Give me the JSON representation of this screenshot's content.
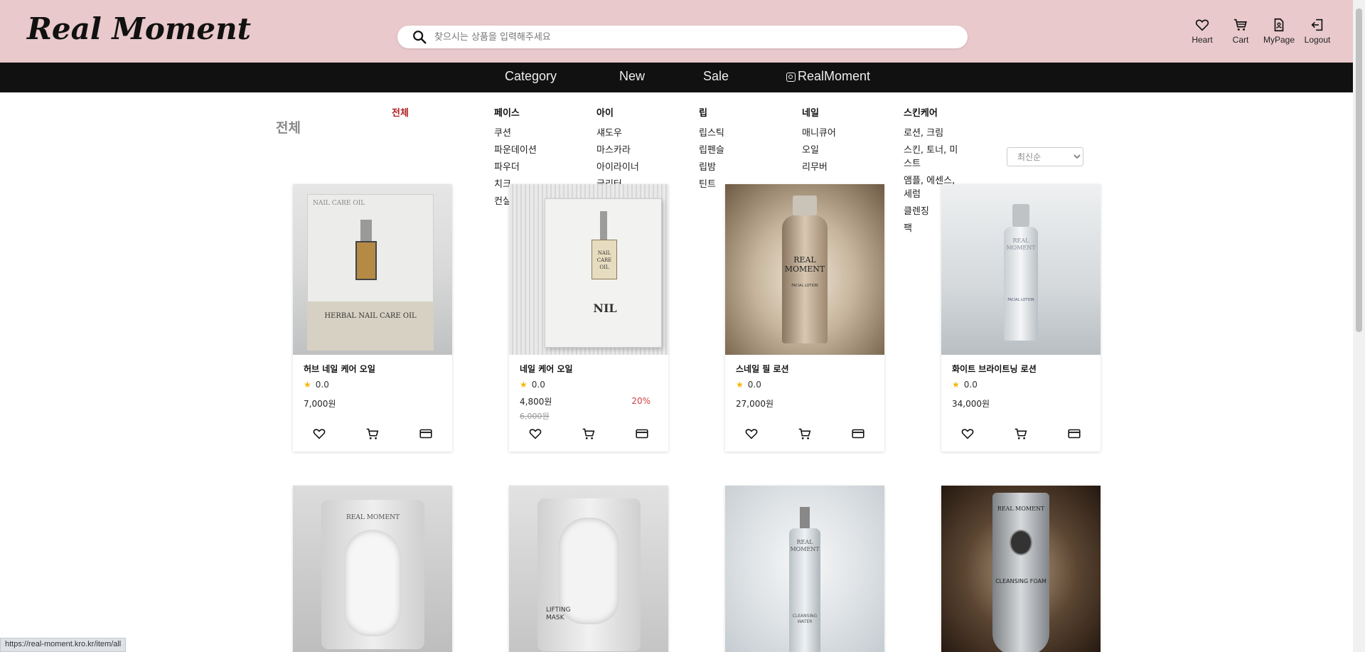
{
  "header": {
    "logo": "Real Moment",
    "search_placeholder": "찾으시는 상품을 입력해주세요",
    "actions": [
      {
        "label": "Heart",
        "icon": "heart-icon"
      },
      {
        "label": "Cart",
        "icon": "cart-icon"
      },
      {
        "label": "MyPage",
        "icon": "document-icon"
      },
      {
        "label": "Logout",
        "icon": "logout-icon"
      }
    ]
  },
  "nav": {
    "items": [
      "Category",
      "New",
      "Sale",
      "RealMoment"
    ],
    "instagram_icon": "instagram-icon"
  },
  "category_menu": {
    "all": "전체",
    "columns": [
      {
        "heading": "페이스",
        "items": [
          "쿠션",
          "파운데이션",
          "파우더",
          "치크",
          "컨실러"
        ]
      },
      {
        "heading": "아이",
        "items": [
          "섀도우",
          "마스카라",
          "아이라이너",
          "글리터"
        ]
      },
      {
        "heading": "립",
        "items": [
          "립스틱",
          "립펜슬",
          "립밤",
          "틴트"
        ]
      },
      {
        "heading": "네일",
        "items": [
          "매니큐어",
          "오일",
          "리무버"
        ]
      },
      {
        "heading": "스킨케어",
        "items": [
          "로션, 크림",
          "스킨, 토너, 미스트",
          "앰플, 에센스, 세럼",
          "클렌징",
          "팩"
        ]
      }
    ]
  },
  "page_title": "전체",
  "sort": {
    "selected": "최신순"
  },
  "products": [
    {
      "name": "허브 네일 케어 오일",
      "rating": "0.0",
      "price": "7,000원"
    },
    {
      "name": "네일 케어 오일",
      "rating": "0.0",
      "price": "4,800원",
      "original_price": "6,000원",
      "discount": "20%"
    },
    {
      "name": "스네일 필 로션",
      "rating": "0.0",
      "price": "27,000원"
    },
    {
      "name": "화이트 브라이트닝 로션",
      "rating": "0.0",
      "price": "34,000원"
    }
  ],
  "product_images": [
    {
      "label_top": "NAIL CARE OIL",
      "label_bottom": "HERBAL NAIL CARE OIL"
    },
    {
      "label_top": "NAIL CARE OIL",
      "label_bottom": "NIL"
    },
    {
      "label_top": "REAL MOMENT",
      "label_bottom": "FACIAL LOTION"
    },
    {
      "label_top": "REAL MOMENT",
      "label_bottom": "FACIAL LOTION"
    },
    {
      "label_top": "REAL MOMENT",
      "label_bottom": ""
    },
    {
      "label_top": "",
      "label_bottom": "LIFTING MASK"
    },
    {
      "label_top": "REAL MOMENT",
      "label_bottom": "CLEANSING WATER"
    },
    {
      "label_top": "REAL MOMENT",
      "label_bottom": "CLEANSING FOAM"
    }
  ],
  "status_url": "https://real-moment.kro.kr/item/all"
}
